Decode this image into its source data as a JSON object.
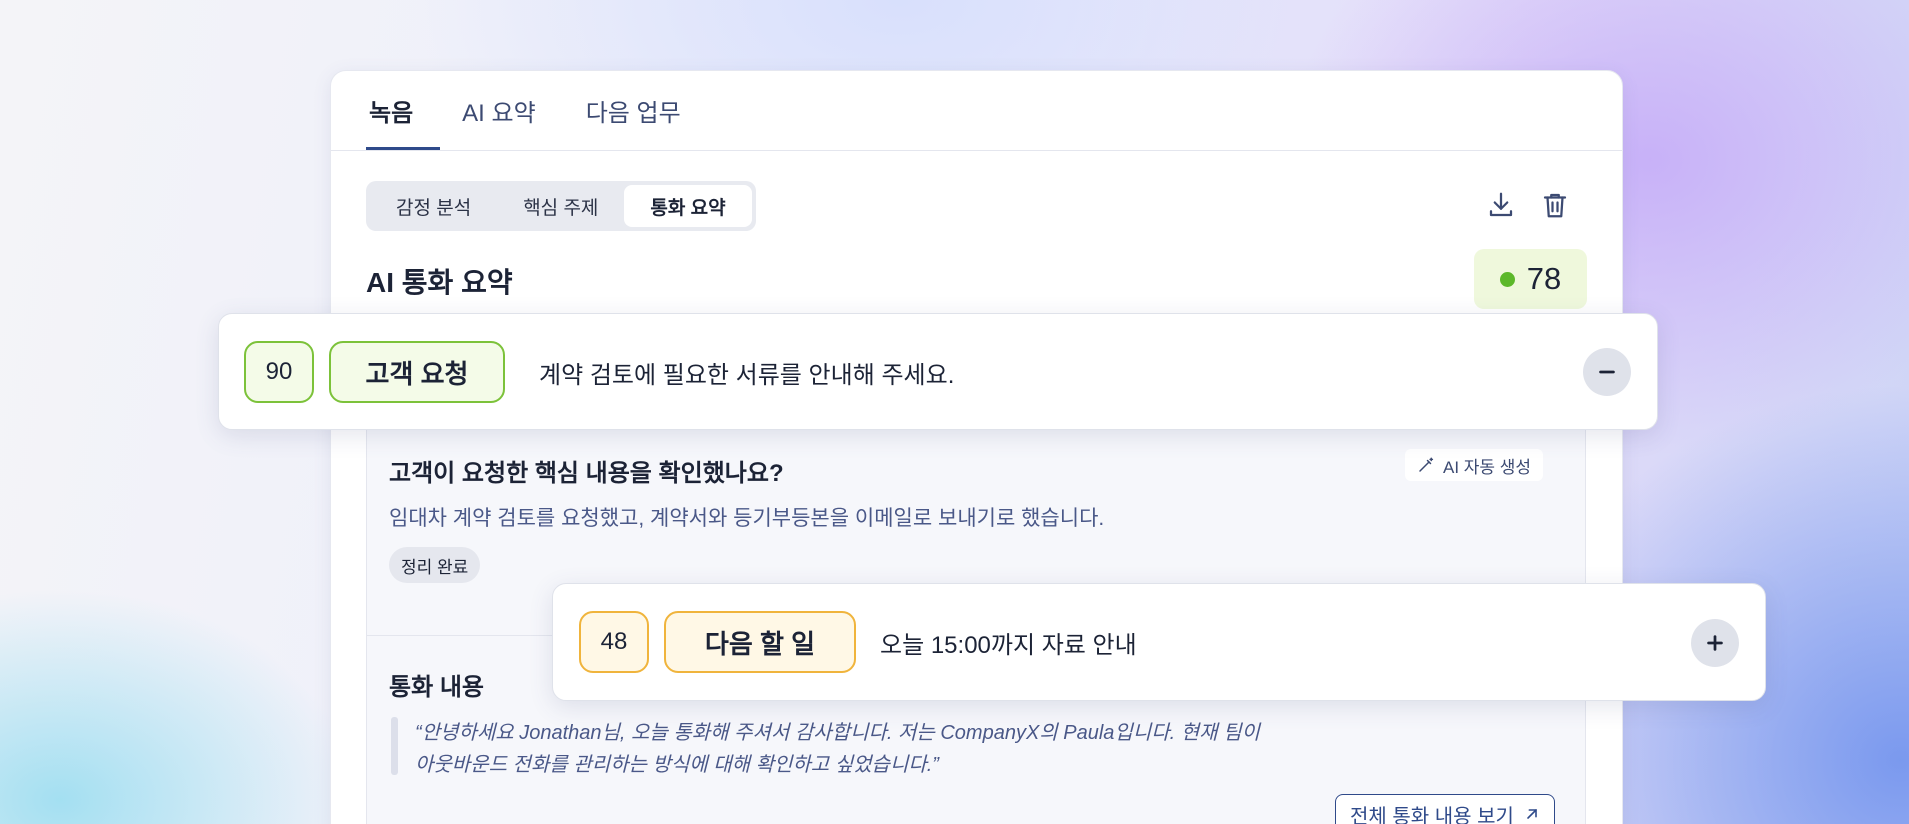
{
  "tabs": [
    {
      "label": "녹음"
    },
    {
      "label": "AI 요약"
    },
    {
      "label": "다음 업무"
    }
  ],
  "segments": [
    {
      "label": "감정 분석"
    },
    {
      "label": "핵심 주제"
    },
    {
      "label": "통화 요약"
    }
  ],
  "toolbar": {
    "download_icon": "download-icon",
    "delete_icon": "trash-icon"
  },
  "summary": {
    "title": "AI 통화 요약",
    "score": "78",
    "score_color": "#5cb82a"
  },
  "question": {
    "title": "고객이 요청한 핵심 내용을 확인했나요?",
    "ai_chip": "AI 자동 생성",
    "description": "임대차 계약 검토를 요청했고, 계약서와 등기부등본을 이메일로 보내기로 했습니다.",
    "status": "정리 완료"
  },
  "call": {
    "title": "통화 내용",
    "quote_line1": "“안녕하세요 Jonathan님, 오늘 통화해 주셔서 감사합니다. 저는 CompanyX의 Paula입니다. 현재 팀이",
    "quote_line2": "아웃바운드 전화를 관리하는 방식에 대해 확인하고 싶었습니다.”",
    "full_link": "전체 통화 내용 보기"
  },
  "float_cards": [
    {
      "score": "90",
      "tag": "고객 요청",
      "text": "계약 검토에 필요한 서류를 안내해 주세요.",
      "accent": "#7cc23a",
      "action": "collapse"
    },
    {
      "score": "48",
      "tag": "다음 할 일",
      "text": "오늘 15:00까지 자료 안내",
      "accent": "#f0b43c",
      "action": "expand"
    }
  ]
}
